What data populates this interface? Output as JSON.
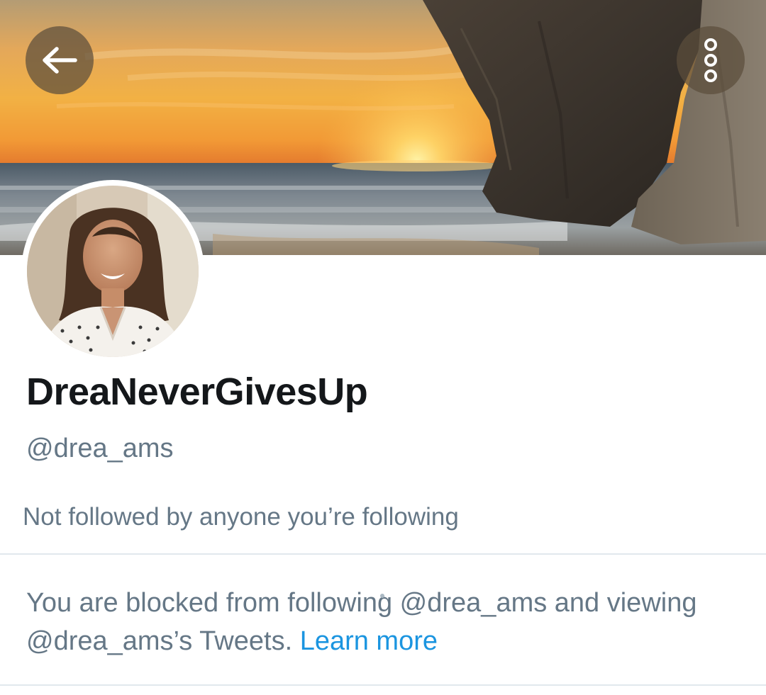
{
  "profile": {
    "display_name": "DreaNeverGivesUp",
    "handle": "@drea_ams",
    "followed_by_text": "Not followed by anyone you’re following"
  },
  "blocked_notice": {
    "text": "You are blocked from following @drea_ams and viewing @drea_ams’s Tweets.",
    "link_label": "Learn more"
  },
  "header": {
    "back_icon": "arrow-left-icon",
    "more_icon": "vertical-ellipsis-icon"
  },
  "colors": {
    "link": "#1b95e0",
    "secondary_text": "#657786",
    "primary_text": "#14171a",
    "divider": "#e1e8ed"
  }
}
